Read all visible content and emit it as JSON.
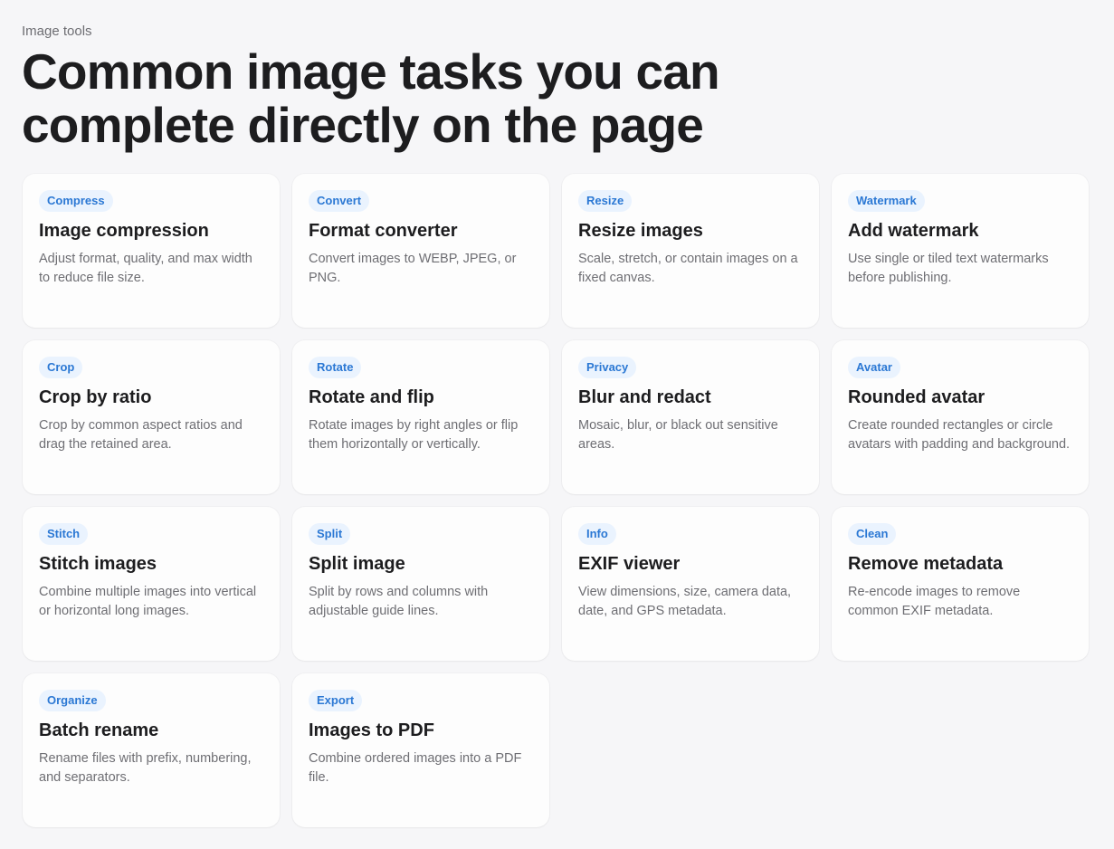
{
  "header": {
    "eyebrow": "Image tools",
    "title": "Common image tasks you can complete directly on the page"
  },
  "colors": {
    "tag_text": "#2b78d4",
    "tag_bg": "#eaf3fe",
    "page_bg": "#f6f6f8"
  },
  "tools": [
    {
      "tag": "Compress",
      "title": "Image compression",
      "desc": "Adjust format, quality, and max width to reduce file size."
    },
    {
      "tag": "Convert",
      "title": "Format converter",
      "desc": "Convert images to WEBP, JPEG, or PNG."
    },
    {
      "tag": "Resize",
      "title": "Resize images",
      "desc": "Scale, stretch, or contain images on a fixed canvas."
    },
    {
      "tag": "Watermark",
      "title": "Add watermark",
      "desc": "Use single or tiled text watermarks before publishing."
    },
    {
      "tag": "Crop",
      "title": "Crop by ratio",
      "desc": "Crop by common aspect ratios and drag the retained area."
    },
    {
      "tag": "Rotate",
      "title": "Rotate and flip",
      "desc": "Rotate images by right angles or flip them horizontally or vertically."
    },
    {
      "tag": "Privacy",
      "title": "Blur and redact",
      "desc": "Mosaic, blur, or black out sensitive areas."
    },
    {
      "tag": "Avatar",
      "title": "Rounded avatar",
      "desc": "Create rounded rectangles or circle avatars with padding and background."
    },
    {
      "tag": "Stitch",
      "title": "Stitch images",
      "desc": "Combine multiple images into vertical or horizontal long images."
    },
    {
      "tag": "Split",
      "title": "Split image",
      "desc": "Split by rows and columns with adjustable guide lines."
    },
    {
      "tag": "Info",
      "title": "EXIF viewer",
      "desc": "View dimensions, size, camera data, date, and GPS metadata."
    },
    {
      "tag": "Clean",
      "title": "Remove metadata",
      "desc": "Re-encode images to remove common EXIF metadata."
    },
    {
      "tag": "Organize",
      "title": "Batch rename",
      "desc": "Rename files with prefix, numbering, and separators."
    },
    {
      "tag": "Export",
      "title": "Images to PDF",
      "desc": "Combine ordered images into a PDF file."
    }
  ]
}
